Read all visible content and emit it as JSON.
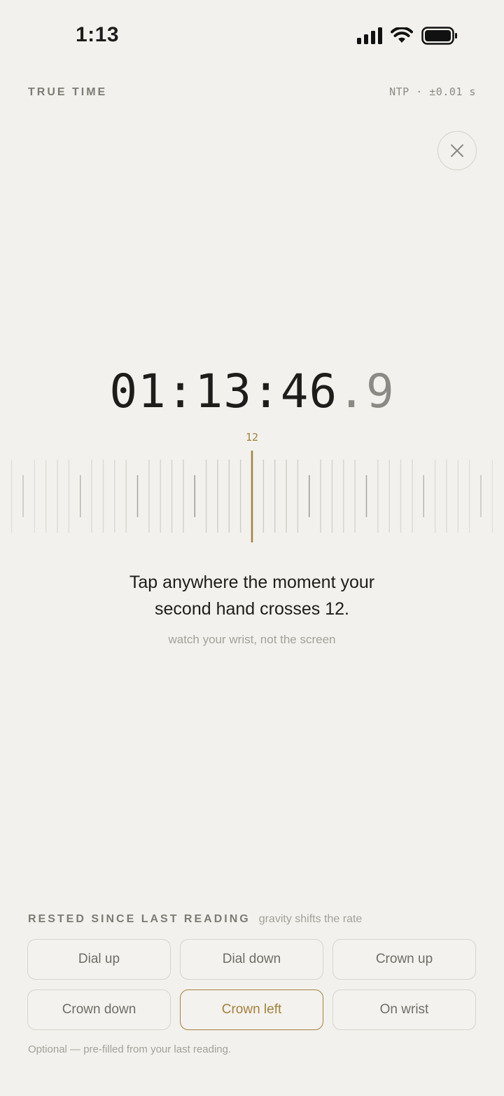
{
  "status_bar": {
    "time": "1:13"
  },
  "header": {
    "brand": "TRUE TIME",
    "sync_status": "NTP · ±0.01 s",
    "close_icon": "close-icon"
  },
  "clock": {
    "main": "01:13:46",
    "fraction": ".9"
  },
  "ruler": {
    "center_label": "12",
    "accent_color": "#a4813d"
  },
  "instruction": {
    "line1": "Tap anywhere the moment your",
    "line2": "second hand crosses 12.",
    "hint": "watch your wrist, not the screen"
  },
  "rested": {
    "title": "RESTED SINCE LAST READING",
    "subtitle": "gravity shifts the rate",
    "options": [
      {
        "label": "Dial up",
        "selected": false
      },
      {
        "label": "Dial down",
        "selected": false
      },
      {
        "label": "Crown up",
        "selected": false
      },
      {
        "label": "Crown down",
        "selected": false
      },
      {
        "label": "Crown left",
        "selected": true
      },
      {
        "label": "On wrist",
        "selected": false
      }
    ],
    "footnote": "Optional — pre-filled from your last reading."
  }
}
